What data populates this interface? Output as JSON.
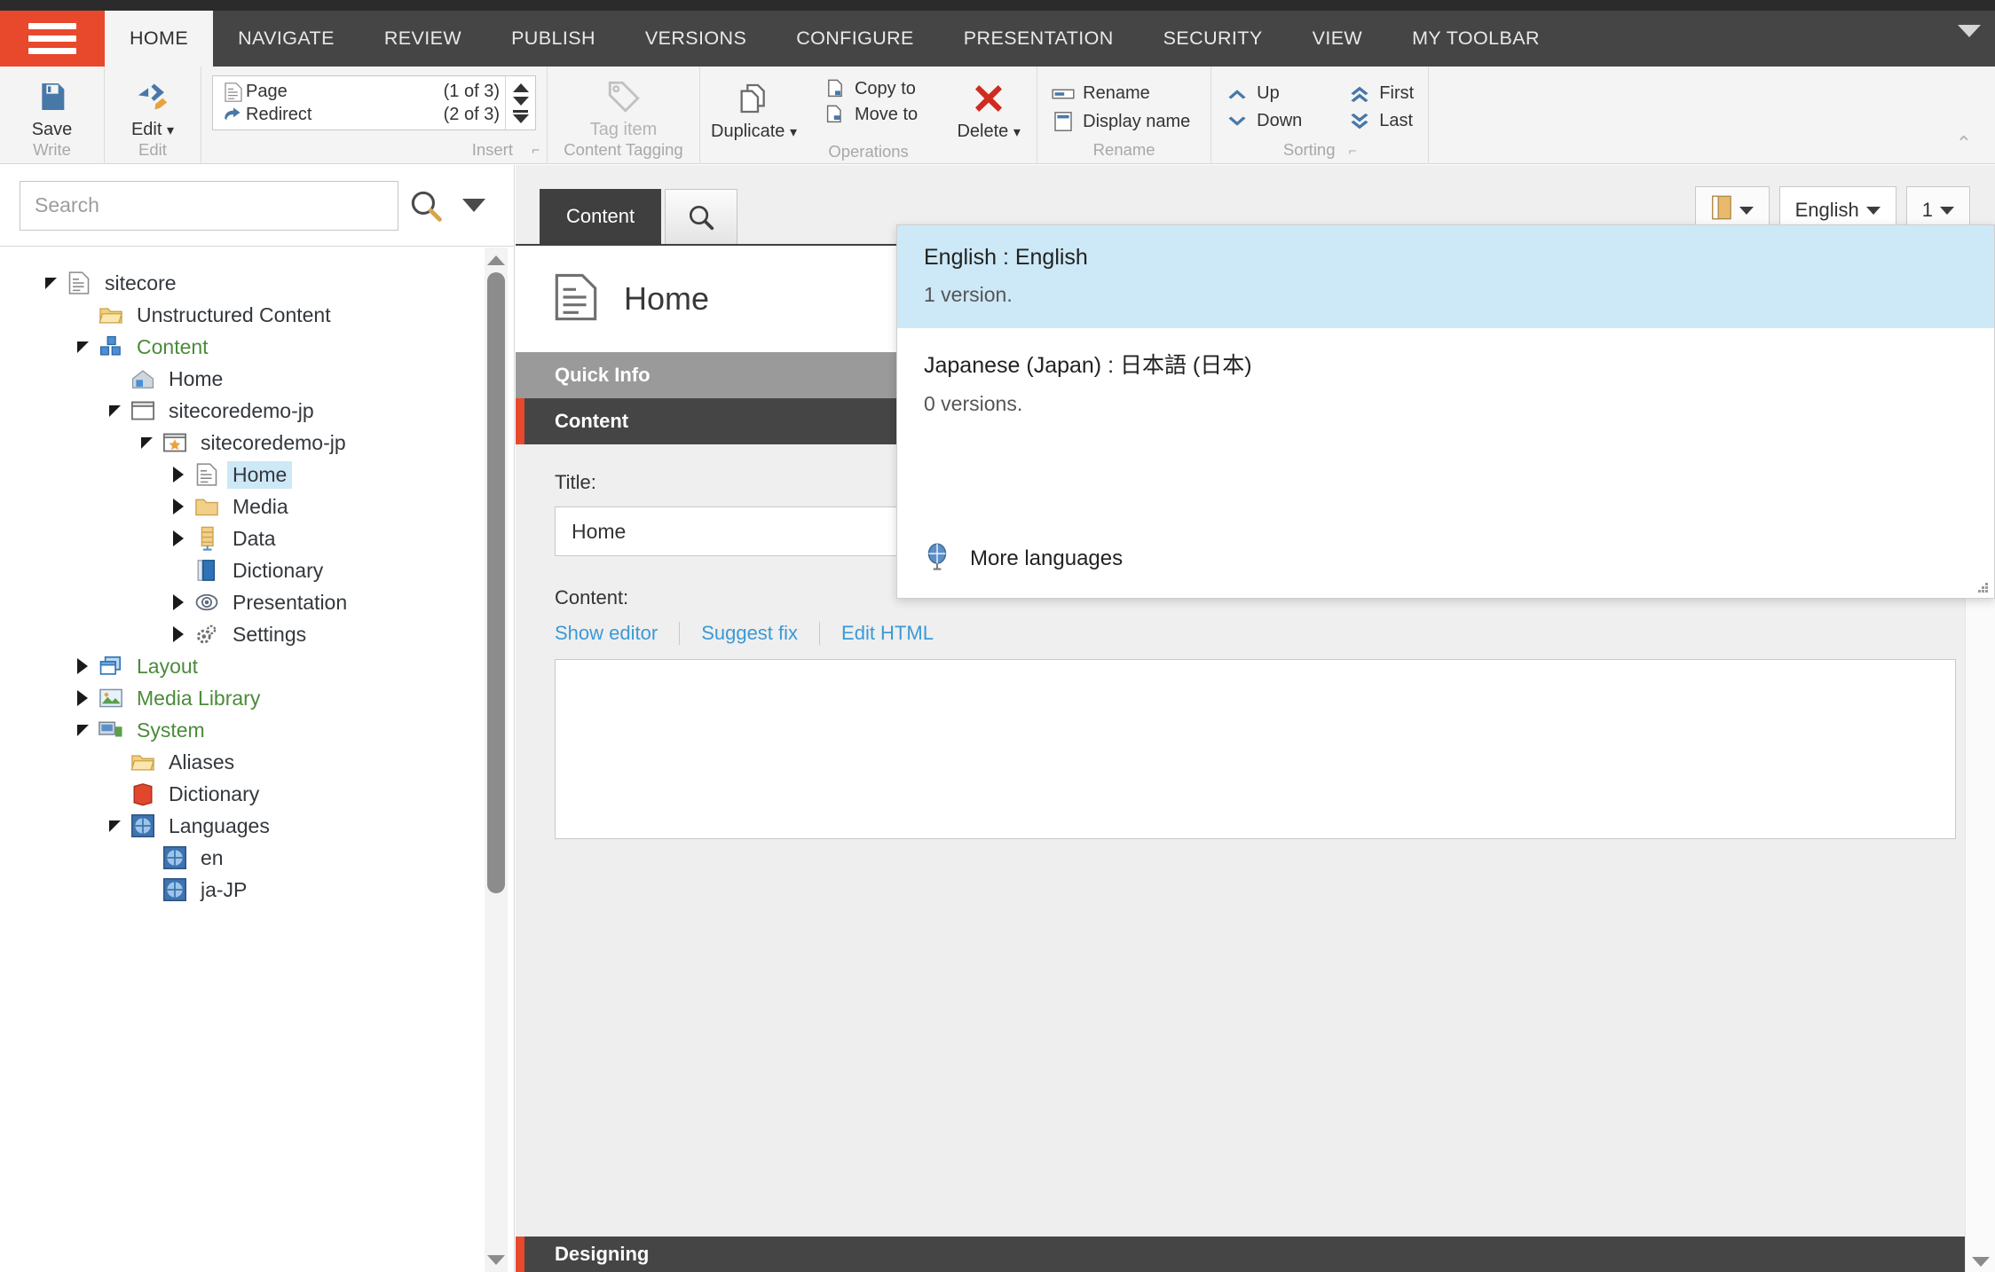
{
  "ribbon": {
    "tabs": [
      {
        "label": "HOME",
        "active": true
      },
      {
        "label": "NAVIGATE",
        "active": false
      },
      {
        "label": "REVIEW",
        "active": false
      },
      {
        "label": "PUBLISH",
        "active": false
      },
      {
        "label": "VERSIONS",
        "active": false
      },
      {
        "label": "CONFIGURE",
        "active": false
      },
      {
        "label": "PRESENTATION",
        "active": false
      },
      {
        "label": "SECURITY",
        "active": false
      },
      {
        "label": "VIEW",
        "active": false
      },
      {
        "label": "MY TOOLBAR",
        "active": false
      }
    ],
    "groups": {
      "write": {
        "label": "Write",
        "save": "Save"
      },
      "edit": {
        "label": "Edit",
        "edit": "Edit"
      },
      "insert": {
        "label": "Insert",
        "page": "Page",
        "page_count": "(1 of 3)",
        "redirect": "Redirect",
        "redirect_count": "(2 of 3)"
      },
      "content_tagging": {
        "label": "Content Tagging",
        "tag_item": "Tag item"
      },
      "operations": {
        "label": "Operations",
        "duplicate": "Duplicate",
        "copy_to": "Copy to",
        "move_to": "Move to",
        "delete": "Delete"
      },
      "rename": {
        "label": "Rename",
        "rename": "Rename",
        "display_name": "Display name"
      },
      "sorting": {
        "label": "Sorting",
        "up": "Up",
        "down": "Down",
        "first": "First",
        "last": "Last"
      }
    }
  },
  "sidebar": {
    "search": {
      "placeholder": "Search",
      "value": ""
    },
    "tree": [
      {
        "label": "sitecore",
        "depth": 0,
        "expander": "down",
        "icon": "document-icon",
        "color": "dark",
        "selected": false
      },
      {
        "label": "Unstructured Content",
        "depth": 1,
        "expander": "none",
        "icon": "folder-open-icon",
        "color": "dark",
        "selected": false
      },
      {
        "label": "Content",
        "depth": 1,
        "expander": "down",
        "icon": "cubes-icon",
        "color": "green",
        "selected": false
      },
      {
        "label": "Home",
        "depth": 2,
        "expander": "none",
        "icon": "house-icon",
        "color": "dark",
        "selected": false
      },
      {
        "label": "sitecoredemo-jp",
        "depth": 2,
        "expander": "down",
        "icon": "window-icon",
        "color": "dark",
        "selected": false
      },
      {
        "label": "sitecoredemo-jp",
        "depth": 3,
        "expander": "down",
        "icon": "star-window-icon",
        "color": "dark",
        "selected": false
      },
      {
        "label": "Home",
        "depth": 4,
        "expander": "right",
        "icon": "document-icon",
        "color": "dark",
        "selected": true
      },
      {
        "label": "Media",
        "depth": 4,
        "expander": "right",
        "icon": "folder-icon",
        "color": "dark",
        "selected": false
      },
      {
        "label": "Data",
        "depth": 4,
        "expander": "right",
        "icon": "data-icon",
        "color": "dark",
        "selected": false
      },
      {
        "label": "Dictionary",
        "depth": 4,
        "expander": "none",
        "icon": "book-icon",
        "color": "dark",
        "selected": false
      },
      {
        "label": "Presentation",
        "depth": 4,
        "expander": "right",
        "icon": "eye-icon",
        "color": "dark",
        "selected": false
      },
      {
        "label": "Settings",
        "depth": 4,
        "expander": "right",
        "icon": "gears-icon",
        "color": "dark",
        "selected": false
      },
      {
        "label": "Layout",
        "depth": 1,
        "expander": "right",
        "icon": "layers-icon",
        "color": "green",
        "selected": false
      },
      {
        "label": "Media Library",
        "depth": 1,
        "expander": "right",
        "icon": "picture-icon",
        "color": "green",
        "selected": false
      },
      {
        "label": "System",
        "depth": 1,
        "expander": "down",
        "icon": "server-icon",
        "color": "green",
        "selected": false
      },
      {
        "label": "Aliases",
        "depth": 2,
        "expander": "none",
        "icon": "folder-open-icon",
        "color": "dark",
        "selected": false
      },
      {
        "label": "Dictionary",
        "depth": 2,
        "expander": "none",
        "icon": "redbook-icon",
        "color": "dark",
        "selected": false
      },
      {
        "label": "Languages",
        "depth": 2,
        "expander": "down",
        "icon": "globe-icon",
        "color": "dark",
        "selected": false
      },
      {
        "label": "en",
        "depth": 3,
        "expander": "none",
        "icon": "globe-icon",
        "color": "dark",
        "selected": false
      },
      {
        "label": "ja-JP",
        "depth": 3,
        "expander": "none",
        "icon": "globe-icon",
        "color": "dark",
        "selected": false
      }
    ]
  },
  "editor": {
    "tabs": [
      {
        "label": "Content"
      }
    ],
    "search_tab_icon": "search-icon",
    "controls": {
      "versions_icon_label": "",
      "language": "English",
      "version": "1"
    },
    "item": {
      "name": "Home",
      "icon": "document-icon"
    },
    "sections": {
      "quick_info": "Quick Info",
      "content": "Content",
      "designing": "Designing"
    },
    "fields": {
      "title_label": "Title:",
      "title_value": "Home",
      "content_label": "Content:",
      "content_value": "",
      "links": [
        "Show editor",
        "Suggest fix",
        "Edit HTML"
      ]
    }
  },
  "language_popup": {
    "items": [
      {
        "title": "English : English",
        "versions": "1 version.",
        "selected": true
      },
      {
        "title": "Japanese (Japan) : 日本語 (日本)",
        "versions": "0 versions.",
        "selected": false
      }
    ],
    "more": "More languages",
    "more_icon": "globe-icon"
  },
  "colors": {
    "accent": "#e8482c",
    "ribbon_dark": "#454545",
    "selection": "#cde8f6",
    "link": "#3b9ad6"
  }
}
